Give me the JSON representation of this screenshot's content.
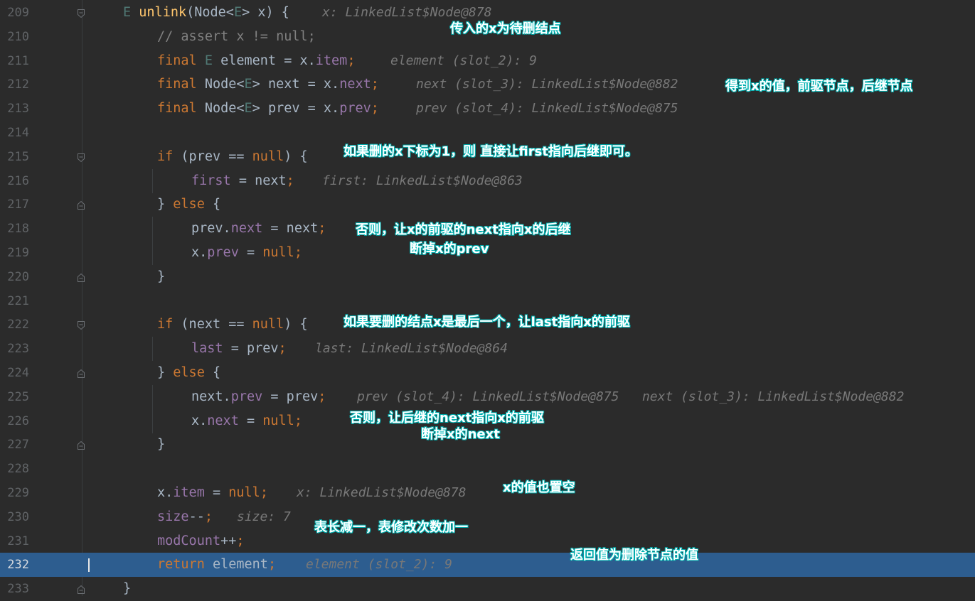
{
  "editor": {
    "current_line": "232",
    "lines": [
      {
        "num": "209",
        "tokens": [
          {
            "t": "E ",
            "c": "tp"
          },
          {
            "t": "unlink",
            "c": "fn"
          },
          {
            "t": "(Node<",
            "c": "op"
          },
          {
            "t": "E",
            "c": "tp"
          },
          {
            "t": "> x) {",
            "c": "op"
          }
        ],
        "hint": "x: LinkedList$Node@878"
      },
      {
        "num": "210",
        "tokens": [
          {
            "t": "// assert x != null;",
            "c": "cm"
          }
        ],
        "hint": ""
      },
      {
        "num": "211",
        "tokens": [
          {
            "t": "final ",
            "c": "kw"
          },
          {
            "t": "E ",
            "c": "tp"
          },
          {
            "t": "element = x.",
            "c": "op"
          },
          {
            "t": "item",
            "c": "field"
          },
          {
            "t": ";",
            "c": "kw"
          }
        ],
        "hint": "element (slot_2): 9"
      },
      {
        "num": "212",
        "tokens": [
          {
            "t": "final ",
            "c": "kw"
          },
          {
            "t": "Node<",
            "c": "op"
          },
          {
            "t": "E",
            "c": "tp"
          },
          {
            "t": "> next = x.",
            "c": "op"
          },
          {
            "t": "next",
            "c": "field"
          },
          {
            "t": ";",
            "c": "kw"
          }
        ],
        "hint": "next (slot_3): LinkedList$Node@882"
      },
      {
        "num": "213",
        "tokens": [
          {
            "t": "final ",
            "c": "kw"
          },
          {
            "t": "Node<",
            "c": "op"
          },
          {
            "t": "E",
            "c": "tp"
          },
          {
            "t": "> prev = x.",
            "c": "op"
          },
          {
            "t": "prev",
            "c": "field"
          },
          {
            "t": ";",
            "c": "kw"
          }
        ],
        "hint": "prev (slot_4): LinkedList$Node@875"
      },
      {
        "num": "214",
        "tokens": [],
        "hint": ""
      },
      {
        "num": "215",
        "tokens": [
          {
            "t": "if ",
            "c": "kw"
          },
          {
            "t": "(prev == ",
            "c": "op"
          },
          {
            "t": "null",
            "c": "kw"
          },
          {
            "t": ") {",
            "c": "op"
          }
        ],
        "hint": ""
      },
      {
        "num": "216",
        "tokens": [
          {
            "t": "first",
            "c": "field"
          },
          {
            "t": " = next",
            "c": "op"
          },
          {
            "t": ";",
            "c": "kw"
          }
        ],
        "hint": "first: LinkedList$Node@863"
      },
      {
        "num": "217",
        "tokens": [
          {
            "t": "} ",
            "c": "op"
          },
          {
            "t": "else ",
            "c": "kw"
          },
          {
            "t": "{",
            "c": "op"
          }
        ],
        "hint": ""
      },
      {
        "num": "218",
        "tokens": [
          {
            "t": "prev.",
            "c": "op"
          },
          {
            "t": "next",
            "c": "field"
          },
          {
            "t": " = next",
            "c": "op"
          },
          {
            "t": ";",
            "c": "kw"
          }
        ],
        "hint": ""
      },
      {
        "num": "219",
        "tokens": [
          {
            "t": "x.",
            "c": "op"
          },
          {
            "t": "prev",
            "c": "field"
          },
          {
            "t": " = ",
            "c": "op"
          },
          {
            "t": "null",
            "c": "kw"
          },
          {
            "t": ";",
            "c": "kw"
          }
        ],
        "hint": ""
      },
      {
        "num": "220",
        "tokens": [
          {
            "t": "}",
            "c": "op"
          }
        ],
        "hint": ""
      },
      {
        "num": "221",
        "tokens": [],
        "hint": ""
      },
      {
        "num": "222",
        "tokens": [
          {
            "t": "if ",
            "c": "kw"
          },
          {
            "t": "(next == ",
            "c": "op"
          },
          {
            "t": "null",
            "c": "kw"
          },
          {
            "t": ") {",
            "c": "op"
          }
        ],
        "hint": ""
      },
      {
        "num": "223",
        "tokens": [
          {
            "t": "last",
            "c": "field"
          },
          {
            "t": " = prev",
            "c": "op"
          },
          {
            "t": ";",
            "c": "kw"
          }
        ],
        "hint": "last: LinkedList$Node@864"
      },
      {
        "num": "224",
        "tokens": [
          {
            "t": "} ",
            "c": "op"
          },
          {
            "t": "else ",
            "c": "kw"
          },
          {
            "t": "{",
            "c": "op"
          }
        ],
        "hint": ""
      },
      {
        "num": "225",
        "tokens": [
          {
            "t": "next.",
            "c": "op"
          },
          {
            "t": "prev",
            "c": "field"
          },
          {
            "t": " = prev",
            "c": "op"
          },
          {
            "t": ";",
            "c": "kw"
          }
        ],
        "hint": "prev (slot_4): LinkedList$Node@875   next (slot_3): LinkedList$Node@882"
      },
      {
        "num": "226",
        "tokens": [
          {
            "t": "x.",
            "c": "op"
          },
          {
            "t": "next",
            "c": "field"
          },
          {
            "t": " = ",
            "c": "op"
          },
          {
            "t": "null",
            "c": "kw"
          },
          {
            "t": ";",
            "c": "kw"
          }
        ],
        "hint": ""
      },
      {
        "num": "227",
        "tokens": [
          {
            "t": "}",
            "c": "op"
          }
        ],
        "hint": ""
      },
      {
        "num": "228",
        "tokens": [],
        "hint": ""
      },
      {
        "num": "229",
        "tokens": [
          {
            "t": "x.",
            "c": "op"
          },
          {
            "t": "item",
            "c": "field"
          },
          {
            "t": " = ",
            "c": "op"
          },
          {
            "t": "null",
            "c": "kw"
          },
          {
            "t": ";",
            "c": "kw"
          }
        ],
        "hint": "x: LinkedList$Node@878"
      },
      {
        "num": "230",
        "tokens": [
          {
            "t": "size",
            "c": "field"
          },
          {
            "t": "--",
            "c": "op"
          },
          {
            "t": ";",
            "c": "kw"
          }
        ],
        "hint": "size: 7"
      },
      {
        "num": "231",
        "tokens": [
          {
            "t": "modCount",
            "c": "field"
          },
          {
            "t": "++",
            "c": "op"
          },
          {
            "t": ";",
            "c": "kw"
          }
        ],
        "hint": ""
      },
      {
        "num": "232",
        "tokens": [
          {
            "t": "return ",
            "c": "kw"
          },
          {
            "t": "element",
            "c": "op"
          },
          {
            "t": ";",
            "c": "kw"
          }
        ],
        "hint": "element (slot_2): 9"
      },
      {
        "num": "233",
        "tokens": [
          {
            "t": "}",
            "c": "op"
          }
        ],
        "hint": ""
      }
    ]
  },
  "annotations": {
    "a1": "传入的x为待删结点",
    "a2": "得到x的值，前驱节点，后继节点",
    "a3": "如果删的x下标为1，则 直接让first指向后继即可。",
    "a4": "否则，让x的前驱的next指向x的后继",
    "a5": "断掉x的prev",
    "a6": "如果要删的结点x是最后一个，让last指向x的前驱",
    "a7": "否则，让后继的next指向x的前驱",
    "a8": "断掉x的next",
    "a9": "x的值也置空",
    "a10": "表长减一，表修改次数加一",
    "a11": "返回值为删除节点的值"
  },
  "colors": {
    "background": "#2b2b2b",
    "current_line": "#2d5d8f",
    "keyword": "#cc7832",
    "function": "#ffc66d",
    "field": "#9876aa",
    "annotation_outline": "#00a8a8"
  }
}
